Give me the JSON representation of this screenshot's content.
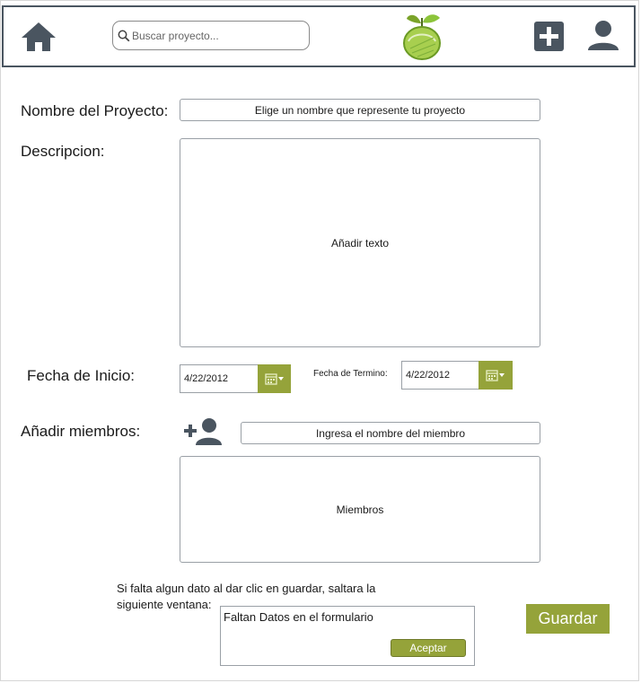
{
  "header": {
    "search": {
      "placeholder": "Buscar proyecto..."
    },
    "icons": {
      "home": "home-icon",
      "search": "search-icon",
      "logo": "apple-logo",
      "add": "add-icon",
      "user": "user-icon"
    }
  },
  "form": {
    "name": {
      "label": "Nombre del Proyecto:",
      "placeholder": "Elige un nombre que represente tu proyecto"
    },
    "description": {
      "label": "Descripcion:",
      "placeholder": "Añadir texto"
    },
    "start_date": {
      "label": "Fecha de Inicio:",
      "value": "4/22/2012"
    },
    "end_date": {
      "label": "Fecha de Termino:",
      "value": "4/22/2012"
    },
    "members": {
      "label": "Añadir miembros:",
      "input_placeholder": "Ingresa el nombre del miembro",
      "list_placeholder": "Miembros",
      "add_icon": "add-user-icon"
    }
  },
  "note": {
    "text": "Si falta algun dato al dar clic en guardar, saltara la siguiente ventana:"
  },
  "dialog": {
    "message": "Faltan Datos en el formulario",
    "accept_label": "Aceptar"
  },
  "actions": {
    "save_label": "Guardar"
  },
  "colors": {
    "accent": "#95a33a",
    "icon": "#4a5560",
    "header_border": "#4a5560"
  }
}
